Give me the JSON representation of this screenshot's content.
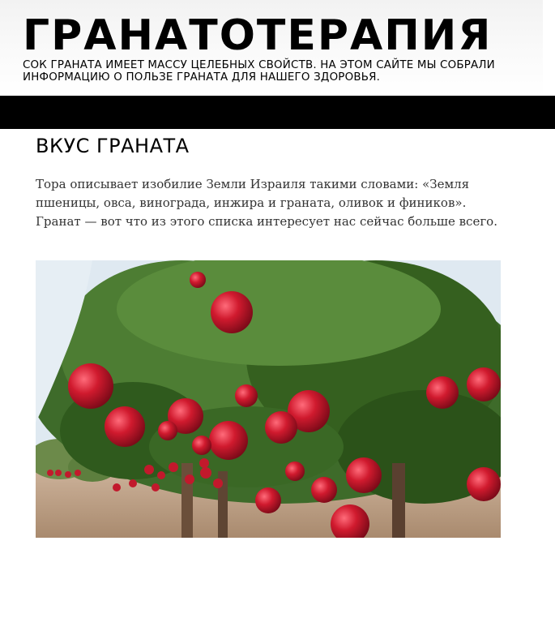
{
  "site": {
    "title": "ГРАНАТОТЕРАПИЯ",
    "description": "СОК ГРАНАТА ИМЕЕТ МАССУ ЦЕЛЕБНЫХ СВОЙСТВ. НА ЭТОМ САЙТЕ МЫ СОБРАЛИ ИНФОРМАЦИЮ О ПОЛЬЗЕ ГРАНАТА ДЛЯ НАШЕГО ЗДОРОВЬЯ."
  },
  "post": {
    "title": "ВКУС ГРАНАТА",
    "text": "Тора описывает изобилие Земли Израиля такими словами: «Земля пшеницы, овса, винограда, инжира и граната, оливок и фиников». Гранат — вот что из этого списка интересует нас сейчас больше всего."
  },
  "colors": {
    "navbar": "#000000",
    "fruit": "#d01a2e",
    "foliage": "#3e6b2a",
    "sky": "#dfe9f1",
    "ground": "#b99a80"
  }
}
